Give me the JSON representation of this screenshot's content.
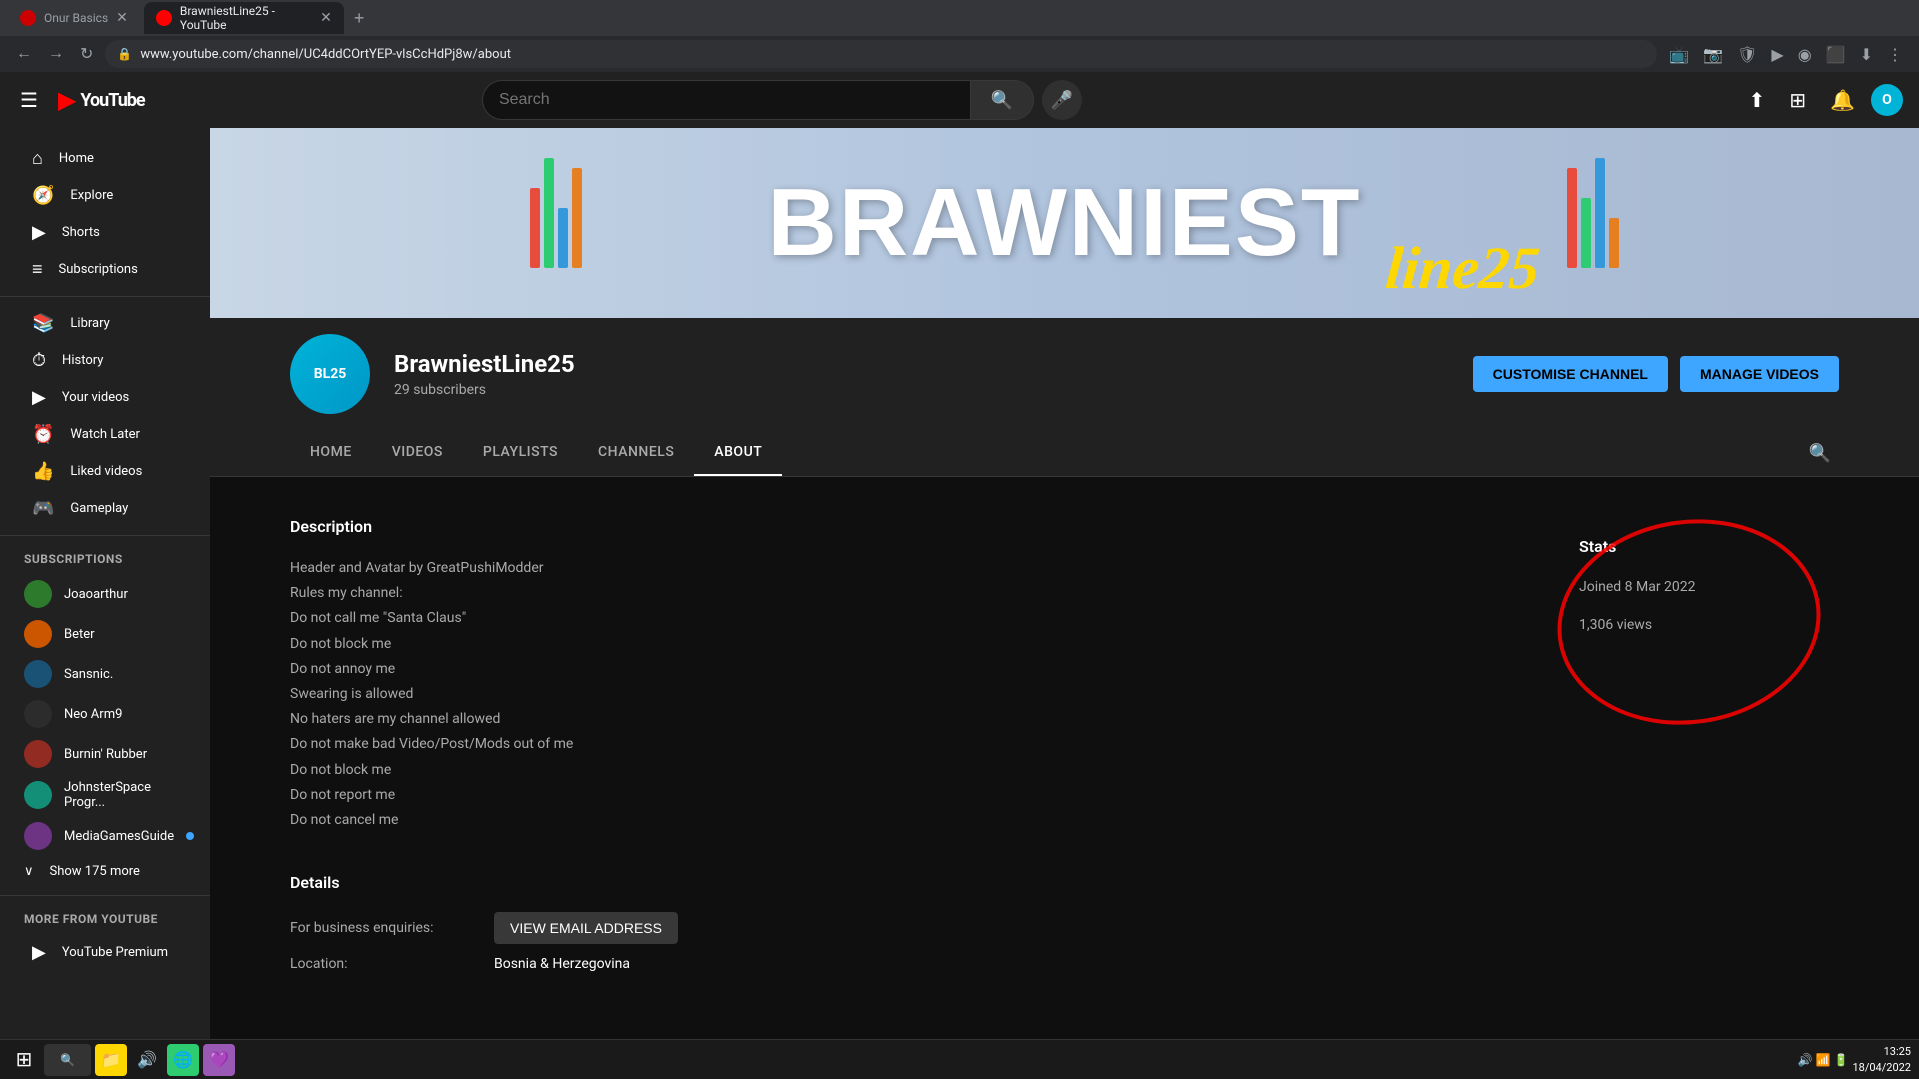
{
  "browser": {
    "tabs": [
      {
        "id": "onur",
        "title": "Onur Basics",
        "active": false,
        "favicon_color": "red"
      },
      {
        "id": "yt",
        "title": "BrawniestLine25 - YouTube",
        "active": true,
        "favicon_color": "red"
      }
    ],
    "url": "www.youtube.com/channel/UC4ddCOrtYEP-vlsCcHdPj8w/about",
    "add_tab_label": "+"
  },
  "header": {
    "hamburger_label": "☰",
    "logo_text": "YouTube",
    "search_placeholder": "Search",
    "search_icon": "🔍",
    "mic_icon": "🎤",
    "upload_icon": "⬆",
    "apps_icon": "⊞",
    "bell_icon": "🔔",
    "avatar_initials": "O"
  },
  "sidebar": {
    "items": [
      {
        "id": "home",
        "label": "Home",
        "icon": "⌂"
      },
      {
        "id": "explore",
        "label": "Explore",
        "icon": "🧭"
      },
      {
        "id": "shorts",
        "label": "Shorts",
        "icon": "▶"
      },
      {
        "id": "subscriptions",
        "label": "Subscriptions",
        "icon": "≡"
      }
    ],
    "library_items": [
      {
        "id": "library",
        "label": "Library",
        "icon": "📚"
      },
      {
        "id": "history",
        "label": "History",
        "icon": "⏱"
      },
      {
        "id": "your-videos",
        "label": "Your videos",
        "icon": "▶"
      },
      {
        "id": "watch-later",
        "label": "Watch Later",
        "icon": "⏰"
      },
      {
        "id": "liked-videos",
        "label": "Liked videos",
        "icon": "👍"
      },
      {
        "id": "gameplay",
        "label": "Gameplay",
        "icon": "🎮"
      }
    ],
    "subscriptions_title": "SUBSCRIPTIONS",
    "subscriptions": [
      {
        "id": "joaoarthur",
        "name": "Joaoarthur",
        "color": "av-green",
        "has_dot": false
      },
      {
        "id": "beter",
        "name": "Beter",
        "color": "av-orange",
        "has_dot": false
      },
      {
        "id": "sansnic",
        "name": "Sansnic.",
        "color": "av-blue",
        "has_dot": false
      },
      {
        "id": "neoarm9",
        "name": "Neo Arm9",
        "color": "av-dark",
        "has_dot": false
      },
      {
        "id": "burnin-rubber",
        "name": "Burnin' Rubber",
        "color": "av-red",
        "has_dot": false
      },
      {
        "id": "johnsterspace",
        "name": "JohnsterSpace Progr...",
        "color": "av-teal",
        "has_dot": false
      },
      {
        "id": "mediagamesguide",
        "name": "MediaGamesGuide",
        "color": "av-purple",
        "has_dot": true
      }
    ],
    "show_more_label": "Show 175 more",
    "more_from_yt_title": "MORE FROM YOUTUBE",
    "yt_premium_label": "YouTube Premium"
  },
  "channel": {
    "banner_text": "BRAWNIESTLINE25",
    "name": "BrawniestLine25",
    "subscribers": "29 subscribers",
    "avatar_initials": "BL25",
    "customise_btn": "CUSTOMISE CHANNEL",
    "manage_btn": "MANAGE VIDEOS",
    "tabs": [
      "HOME",
      "VIDEOS",
      "PLAYLISTS",
      "CHANNELS",
      "ABOUT"
    ],
    "active_tab": "ABOUT"
  },
  "about": {
    "description_title": "Description",
    "description_lines": [
      "Header and Avatar by GreatPushiModder",
      "Rules my channel:",
      "Do not call me \"Santa Claus\"",
      "Do not block me",
      "Do not annoy me",
      "Swearing is allowed",
      "No haters are my channel allowed",
      "Do not make bad Video/Post/Mods out of me",
      "Do not block me",
      "Do not report me",
      "Do not cancel me"
    ],
    "details_title": "Details",
    "business_label": "For business enquiries:",
    "view_email_btn": "VIEW EMAIL ADDRESS",
    "location_label": "Location:",
    "location_value": "Bosnia & Herzegovina",
    "stats": {
      "title": "Stats",
      "joined_label": "Joined 8 Mar 2022",
      "views_label": "1,306 views"
    }
  },
  "taskbar": {
    "time": "13:25",
    "date": "18/04/2022",
    "start_icon": "⊞",
    "apps": [
      "📁",
      "🔊",
      "🌐",
      "💜"
    ]
  }
}
